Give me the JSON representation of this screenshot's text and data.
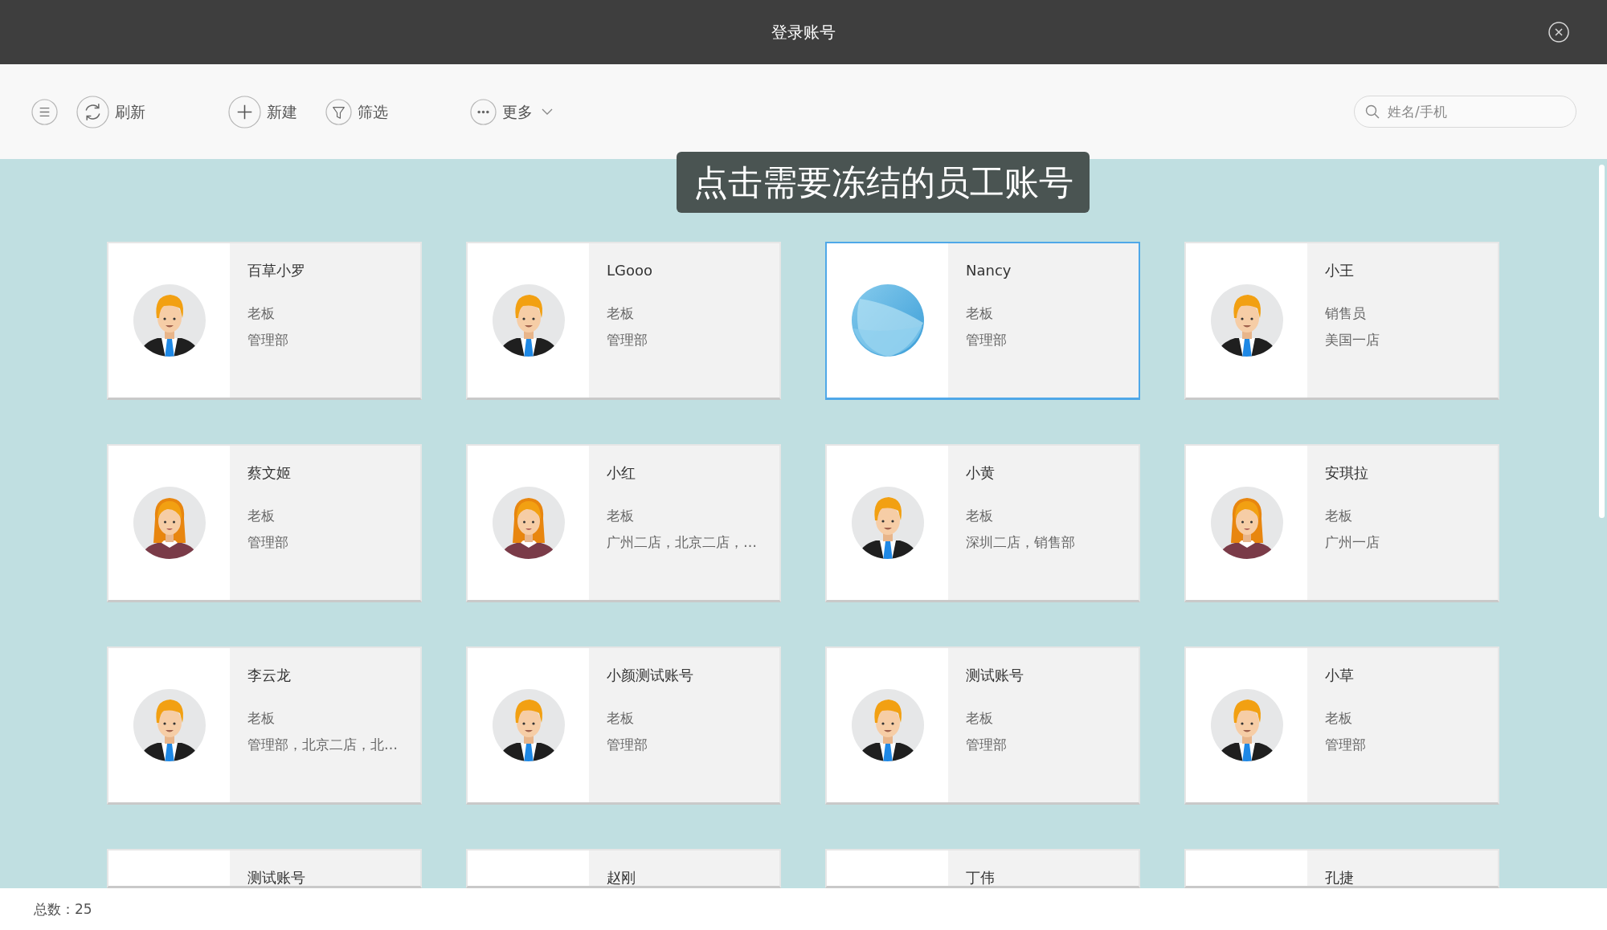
{
  "window": {
    "title": "登录账号"
  },
  "toolbar": {
    "buttons": [
      {
        "kind": "menu"
      },
      {
        "kind": "refresh",
        "label": "刷新"
      },
      {
        "kind": "new",
        "label": "新建"
      },
      {
        "kind": "filter",
        "label": "筛选"
      },
      {
        "kind": "more",
        "label": "更多"
      }
    ],
    "search": {
      "placeholder": "姓名/手机"
    }
  },
  "hint": "点击需要冻结的员工账号",
  "cards": [
    {
      "kind": "man",
      "name": "百草小罗",
      "role": "老板",
      "department": "管理部",
      "selected": false
    },
    {
      "kind": "man",
      "name": "LGooo",
      "role": "老板",
      "department": "管理部",
      "selected": false
    },
    {
      "kind": "logo",
      "name": "Nancy",
      "role": "老板",
      "department": "管理部",
      "selected": true
    },
    {
      "kind": "man",
      "name": "小王",
      "role": "销售员",
      "department": "美国一店",
      "selected": false
    },
    {
      "kind": "woman",
      "name": "蔡文姬",
      "role": "老板",
      "department": "管理部",
      "selected": false
    },
    {
      "kind": "woman",
      "name": "小红",
      "role": "老板",
      "department": "广州二店，北京二店，…",
      "selected": false
    },
    {
      "kind": "man",
      "name": "小黄",
      "role": "老板",
      "department": "深圳二店，销售部",
      "selected": false
    },
    {
      "kind": "woman",
      "name": "安琪拉",
      "role": "老板",
      "department": "广州一店",
      "selected": false
    },
    {
      "kind": "man",
      "name": "李云龙",
      "role": "老板",
      "department": "管理部，北京二店，北…",
      "selected": false
    },
    {
      "kind": "man",
      "name": "小颜测试账号",
      "role": "老板",
      "department": "管理部",
      "selected": false
    },
    {
      "kind": "man",
      "name": "测试账号",
      "role": "老板",
      "department": "管理部",
      "selected": false
    },
    {
      "kind": "man",
      "name": "小草",
      "role": "老板",
      "department": "管理部",
      "selected": false
    },
    {
      "name": "测试账号",
      "selected": false
    },
    {
      "name": "赵刚",
      "selected": false
    },
    {
      "name": "丁伟",
      "selected": false
    },
    {
      "name": "孔捷",
      "selected": false
    }
  ],
  "status_bar": {
    "total": "总数：25"
  }
}
